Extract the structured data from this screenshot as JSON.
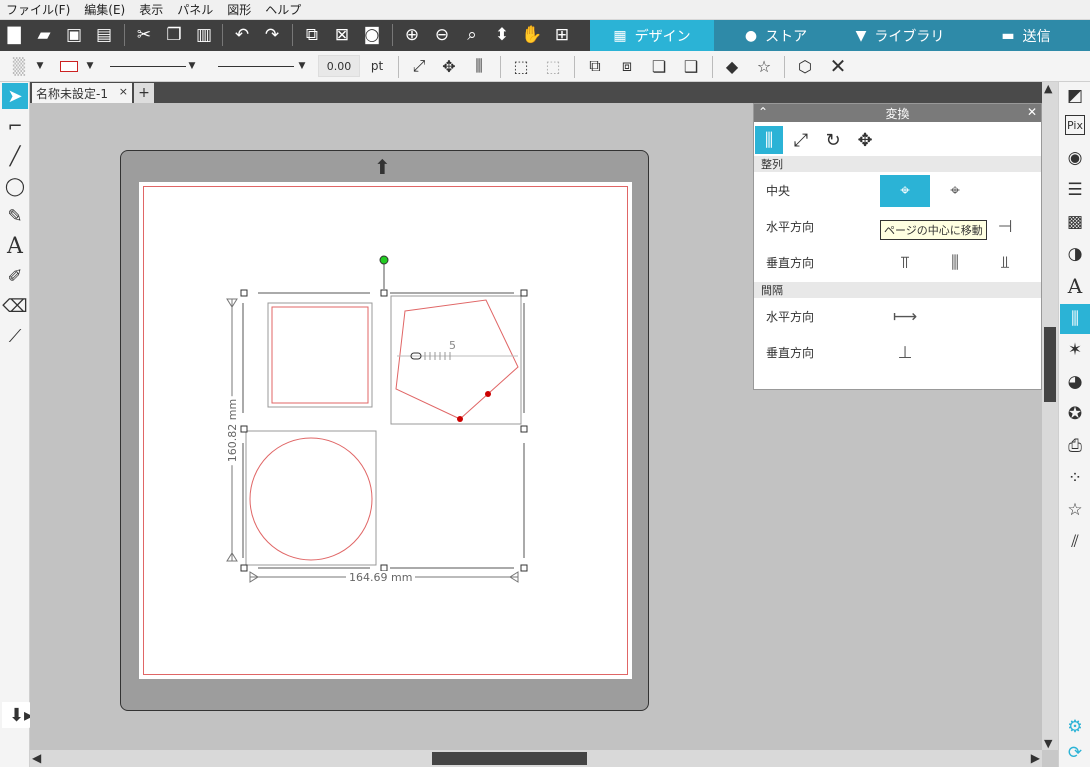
{
  "menu": [
    "ファイル(F)",
    "編集(E)",
    "表示",
    "パネル",
    "図形",
    "ヘルプ"
  ],
  "nav_tabs": {
    "design": "デザイン",
    "store": "ストア",
    "library": "ライブラリ",
    "send": "送信"
  },
  "toolbar2": {
    "line_width_value": "0.00",
    "line_width_unit": "pt"
  },
  "document_tab": {
    "title": "名称未設定-1",
    "close": "×",
    "add": "+"
  },
  "canvas": {
    "width_label": "164.69 mm",
    "height_label": "160.82 mm",
    "ruler_label": "5"
  },
  "panel": {
    "title": "変換",
    "align_section": "整列",
    "center_label": "中央",
    "horizontal_label": "水平方向",
    "vertical_label": "垂直方向",
    "spacing_section": "間隔",
    "spacing_horizontal_label": "水平方向",
    "spacing_vertical_label": "垂直方向",
    "tooltip": "ページの中心に移動"
  },
  "colors": {
    "accent": "#2bb3d6",
    "cut_line": "#e06666",
    "handle_green": "#22cc22"
  }
}
